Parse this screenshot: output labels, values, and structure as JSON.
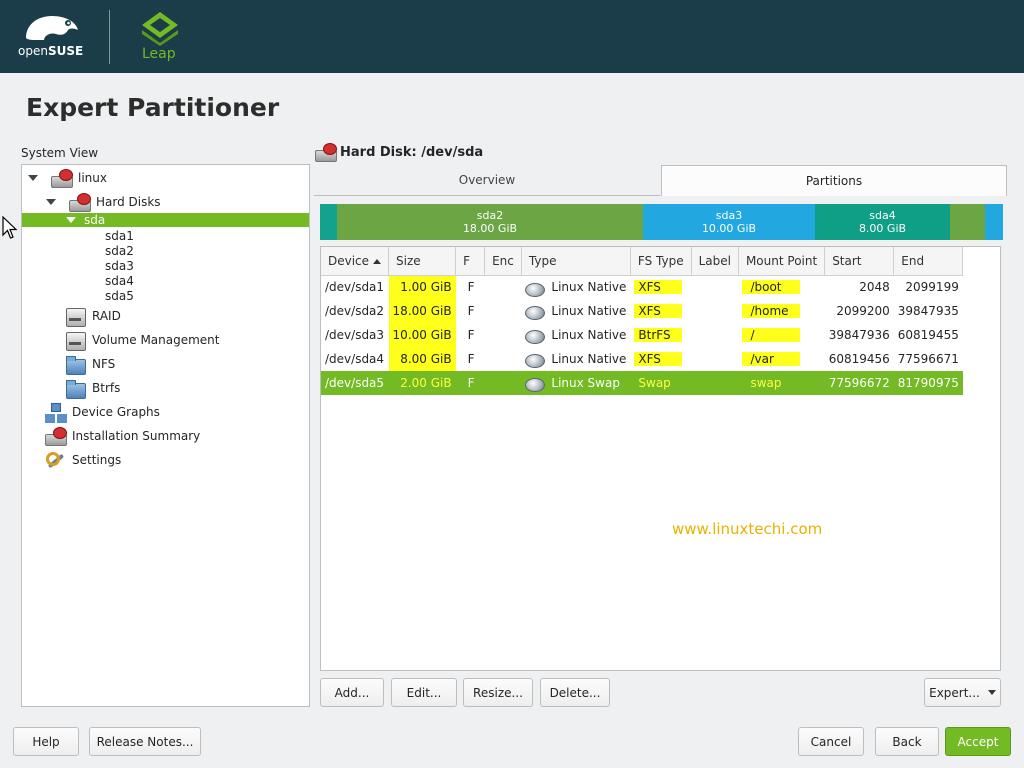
{
  "header": {
    "logo_text_open": "open",
    "logo_text_suse": "SUSE",
    "leap_text": "Leap"
  },
  "page_title": "Expert Partitioner",
  "left": {
    "system_view_label": "System View",
    "tree": [
      {
        "label": "linux",
        "icon": "hard-disk-icon"
      },
      {
        "label": "Hard Disks",
        "icon": "hard-disk-icon"
      },
      {
        "label": "sda",
        "selected": true
      },
      {
        "label": "sda1"
      },
      {
        "label": "sda2"
      },
      {
        "label": "sda3"
      },
      {
        "label": "sda4"
      },
      {
        "label": "sda5"
      },
      {
        "label": "RAID",
        "icon": "raid-icon"
      },
      {
        "label": "Volume Management",
        "icon": "volume-management-icon"
      },
      {
        "label": "NFS",
        "icon": "nfs-icon"
      },
      {
        "label": "Btrfs",
        "icon": "btrfs-icon"
      },
      {
        "label": "Device Graphs",
        "icon": "device-graphs-icon"
      },
      {
        "label": "Installation Summary",
        "icon": "installation-summary-icon"
      },
      {
        "label": "Settings",
        "icon": "settings-icon"
      }
    ]
  },
  "right": {
    "disk_title": "Hard Disk: /dev/sda",
    "tabs": {
      "overview": "Overview",
      "partitions": "Partitions"
    },
    "diskbar": [
      {
        "name": "",
        "size": "",
        "color": "#13a28d"
      },
      {
        "name": "sda2",
        "size": "18.00 GiB",
        "color": "#6ba544"
      },
      {
        "name": "sda3",
        "size": "10.00 GiB",
        "color": "#23a7e0"
      },
      {
        "name": "sda4",
        "size": "8.00 GiB",
        "color": "#0f9f86"
      },
      {
        "name": "",
        "size": "",
        "color": "#6ba544"
      },
      {
        "name": "",
        "size": "",
        "color": "#23a7e0"
      }
    ],
    "columns": [
      "Device",
      "Size",
      "F",
      "Enc",
      "Type",
      "FS Type",
      "Label",
      "Mount Point",
      "Start",
      "End"
    ],
    "rows": [
      {
        "device": "/dev/sda1",
        "size": "1.00 GiB",
        "f": "F",
        "enc": "",
        "type": "Linux Native",
        "fs": "XFS",
        "label": "",
        "mount": "/boot",
        "start": "2048",
        "end": "2099199"
      },
      {
        "device": "/dev/sda2",
        "size": "18.00 GiB",
        "f": "F",
        "enc": "",
        "type": "Linux Native",
        "fs": "XFS",
        "label": "",
        "mount": "/home",
        "start": "2099200",
        "end": "39847935"
      },
      {
        "device": "/dev/sda3",
        "size": "10.00 GiB",
        "f": "F",
        "enc": "",
        "type": "Linux Native",
        "fs": "BtrFS",
        "label": "",
        "mount": "/",
        "start": "39847936",
        "end": "60819455"
      },
      {
        "device": "/dev/sda4",
        "size": "8.00 GiB",
        "f": "F",
        "enc": "",
        "type": "Linux Native",
        "fs": "XFS",
        "label": "",
        "mount": "/var",
        "start": "60819456",
        "end": "77596671"
      },
      {
        "device": "/dev/sda5",
        "size": "2.00 GiB",
        "f": "F",
        "enc": "",
        "type": "Linux Swap",
        "fs": "Swap",
        "label": "",
        "mount": "swap",
        "start": "77596672",
        "end": "81790975",
        "selected": true
      }
    ],
    "watermark": "www.linuxtechi.com",
    "actions": {
      "add": "Add...",
      "edit": "Edit...",
      "resize": "Resize...",
      "delete": "Delete...",
      "expert": "Expert..."
    }
  },
  "footer": {
    "help": "Help",
    "release_notes": "Release Notes...",
    "cancel": "Cancel",
    "back": "Back",
    "accept": "Accept"
  },
  "colors": {
    "accent": "#73ba25",
    "header_bg": "#1b3d4a",
    "highlight": "#ffff1c"
  }
}
